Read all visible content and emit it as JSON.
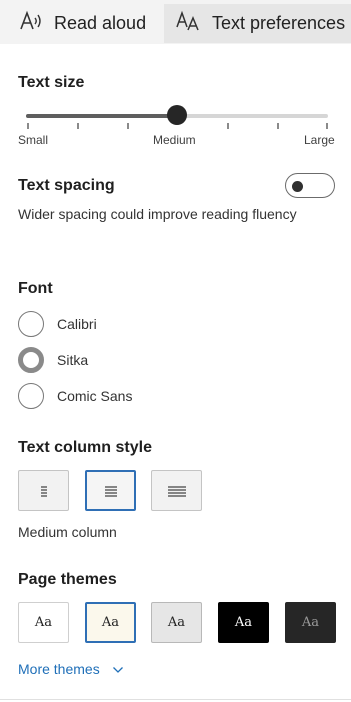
{
  "tabs": {
    "read_aloud": "Read aloud",
    "text_preferences": "Text preferences",
    "active": "text_preferences"
  },
  "text_size": {
    "title": "Text size",
    "min_label": "Small",
    "mid_label": "Medium",
    "max_label": "Large",
    "value_fraction": 0.5
  },
  "text_spacing": {
    "title": "Text spacing",
    "description": "Wider spacing could improve reading fluency",
    "enabled": false
  },
  "font": {
    "title": "Font",
    "options": [
      "Calibri",
      "Sitka",
      "Comic Sans"
    ],
    "selected": "Sitka"
  },
  "column_style": {
    "title": "Text column style",
    "options": [
      "narrow",
      "medium",
      "wide"
    ],
    "selected": "medium",
    "selected_label": "Medium column"
  },
  "page_themes": {
    "title": "Page themes",
    "sample_text": "Aa",
    "themes": [
      {
        "name": "light",
        "bg": "#ffffff",
        "fg": "#222222",
        "border": "#cfcfcf"
      },
      {
        "name": "sepia",
        "bg": "#fbf8ec",
        "fg": "#222222",
        "border": "#2f6fb5",
        "selected": true
      },
      {
        "name": "gray",
        "bg": "#e6e6e6",
        "fg": "#222222",
        "border": "#b8b8b8"
      },
      {
        "name": "black",
        "bg": "#000000",
        "fg": "#ffffff",
        "border": "#000000"
      },
      {
        "name": "dark",
        "bg": "#262626",
        "fg": "#9a9a9a",
        "border": "#262626"
      }
    ],
    "more_label": "More themes"
  },
  "colors": {
    "accent": "#1f6fb8",
    "selected_border": "#2f6fb5"
  }
}
